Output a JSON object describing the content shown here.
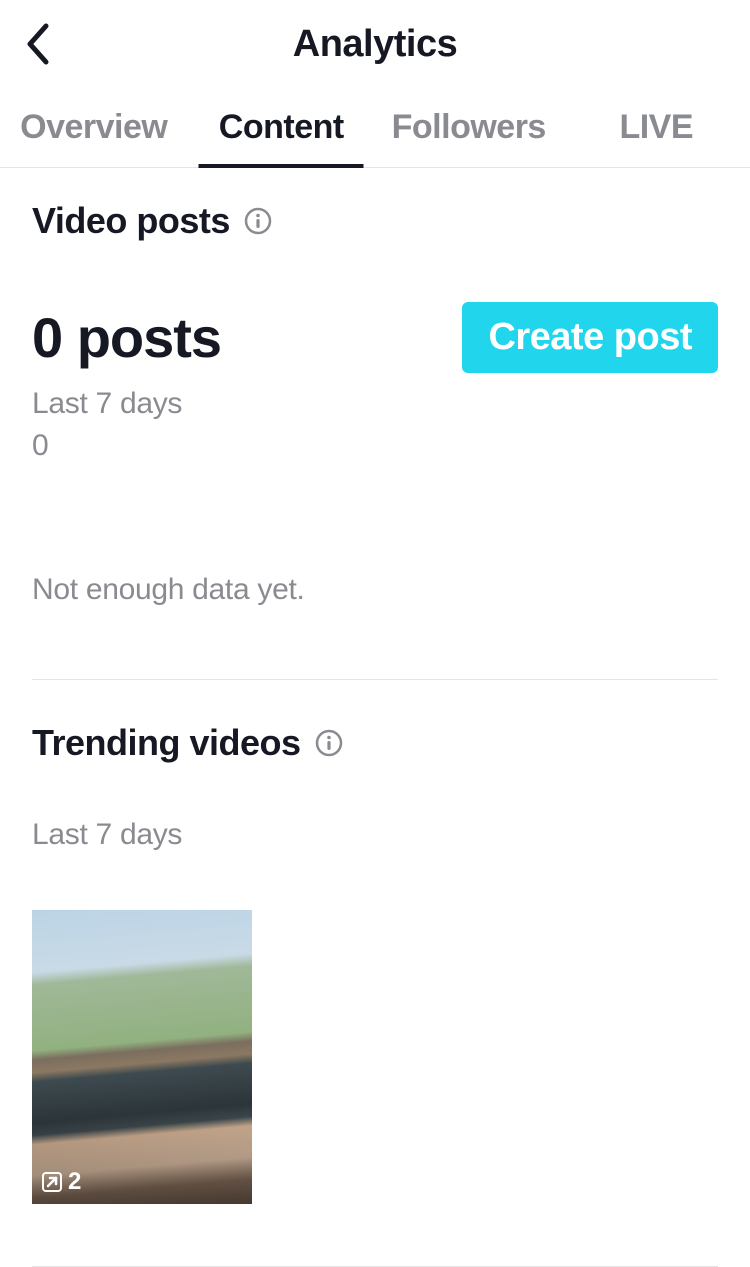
{
  "header": {
    "title": "Analytics"
  },
  "tabs": {
    "items": [
      {
        "label": "Overview"
      },
      {
        "label": "Content"
      },
      {
        "label": "Followers"
      },
      {
        "label": "LIVE"
      }
    ],
    "activeIndex": 1
  },
  "videoPosts": {
    "title": "Video posts",
    "count_label": "0 posts",
    "period_label": "Last 7 days",
    "period_value": "0",
    "not_enough": "Not enough data yet.",
    "create_label": "Create post"
  },
  "trending": {
    "title": "Trending videos",
    "period_label": "Last 7 days",
    "items": [
      {
        "views": "2"
      }
    ]
  },
  "colors": {
    "accent": "#20d5ec",
    "muted": "#8a8b91",
    "text": "#161823"
  }
}
